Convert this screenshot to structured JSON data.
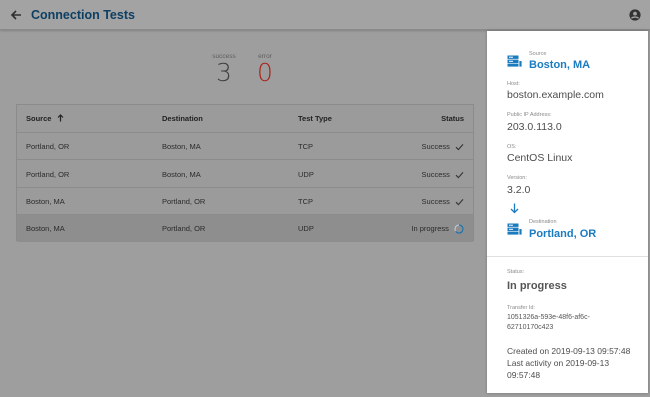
{
  "header": {
    "title": "Connection Tests"
  },
  "summary": {
    "success_label": "success",
    "success_count": "3",
    "error_label": "error",
    "error_count": "0"
  },
  "table": {
    "columns": [
      "Source",
      "Destination",
      "Test Type",
      "Status"
    ],
    "rows": [
      {
        "source": "Portland, OR",
        "destination": "Boston, MA",
        "type": "TCP",
        "status": "Success"
      },
      {
        "source": "Portland, OR",
        "destination": "Boston, MA",
        "type": "UDP",
        "status": "Success"
      },
      {
        "source": "Boston, MA",
        "destination": "Portland, OR",
        "type": "TCP",
        "status": "Success"
      },
      {
        "source": "Boston, MA",
        "destination": "Portland, OR",
        "type": "UDP",
        "status": "In progress"
      }
    ]
  },
  "details": {
    "source_label": "Source",
    "source": "Boston, MA",
    "host_label": "Host:",
    "host": "boston.example.com",
    "ip_label": "Public IP Address:",
    "ip": "203.0.113.0",
    "os_label": "OS:",
    "os": "CentOS Linux",
    "version_label": "Version:",
    "version": "3.2.0",
    "destination_label": "Destination",
    "destination": "Portland, OR",
    "status_label": "Status:",
    "status": "In progress",
    "transfer_label": "Transfer Id:",
    "transfer_line1": "1051326a-593e-48f6-af6c-",
    "transfer_line2": "62710170c423",
    "created": "Created on 2019-09-13 09:57:48",
    "last_activity_line1": "Last activity on 2019-09-13",
    "last_activity_line2": "09:57:48"
  },
  "colors": {
    "accent": "#1a7bbf",
    "error": "#a8241c",
    "header_title": "#0d3f63"
  }
}
